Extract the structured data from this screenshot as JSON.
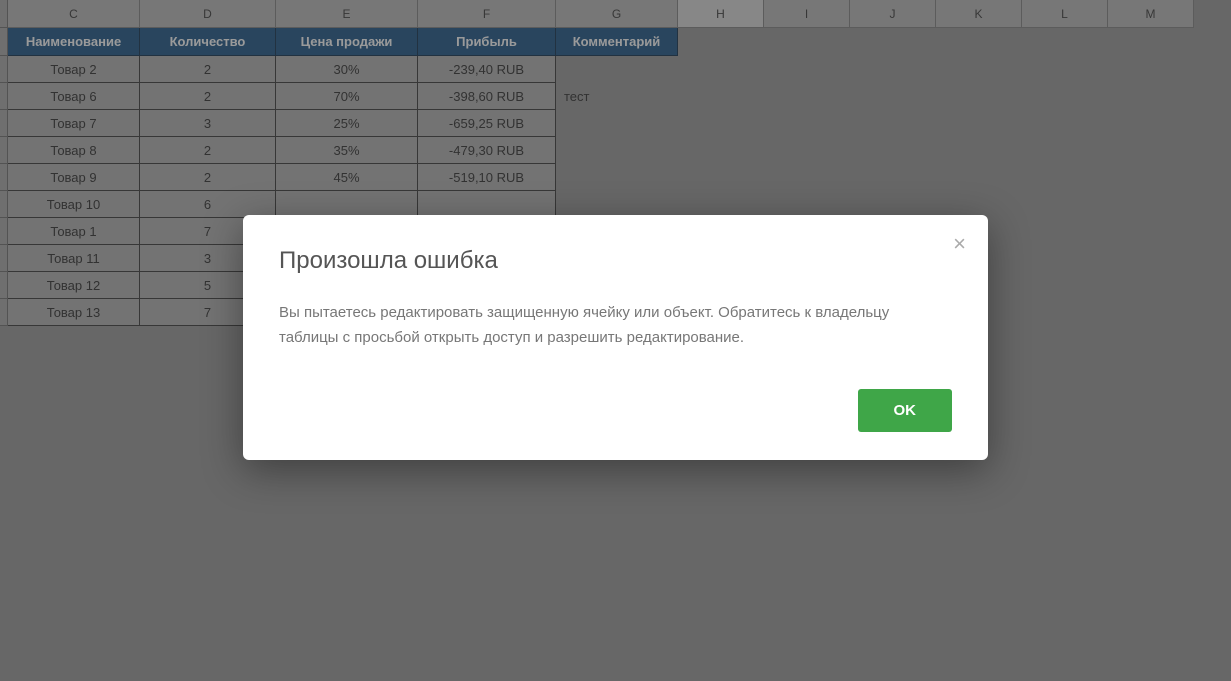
{
  "columns": [
    "C",
    "D",
    "E",
    "F",
    "G",
    "H",
    "I",
    "J",
    "K",
    "L",
    "M"
  ],
  "active_column": "H",
  "table": {
    "headers": [
      "Наименование",
      "Количество",
      "Цена продажи",
      "Прибыль",
      "Комментарий"
    ],
    "rows": [
      {
        "name": "Товар 2",
        "qty": "2",
        "price": "30%",
        "profit": "-239,40 RUB",
        "comment": ""
      },
      {
        "name": "Товар 6",
        "qty": "2",
        "price": "70%",
        "profit": "-398,60 RUB",
        "comment": "тест"
      },
      {
        "name": "Товар 7",
        "qty": "3",
        "price": "25%",
        "profit": "-659,25 RUB",
        "comment": ""
      },
      {
        "name": "Товар 8",
        "qty": "2",
        "price": "35%",
        "profit": "-479,30 RUB",
        "comment": ""
      },
      {
        "name": "Товар 9",
        "qty": "2",
        "price": "45%",
        "profit": "-519,10 RUB",
        "comment": ""
      },
      {
        "name": "Товар 10",
        "qty": "6",
        "price": "",
        "profit": "",
        "comment": ""
      },
      {
        "name": "Товар 1",
        "qty": "7",
        "price": "",
        "profit": "",
        "comment": ""
      },
      {
        "name": "Товар 11",
        "qty": "3",
        "price": "",
        "profit": "",
        "comment": ""
      },
      {
        "name": "Товар 12",
        "qty": "5",
        "price": "",
        "profit": "",
        "comment": ""
      },
      {
        "name": "Товар 13",
        "qty": "7",
        "price": "",
        "profit": "",
        "comment": ""
      }
    ]
  },
  "dialog": {
    "title": "Произошла ошибка",
    "body": "Вы пытаетесь редактировать защищенную ячейку или объект. Обратитесь к владельцу таблицы с просьбой открыть доступ и разрешить редактирование.",
    "ok": "OK",
    "close": "×"
  }
}
